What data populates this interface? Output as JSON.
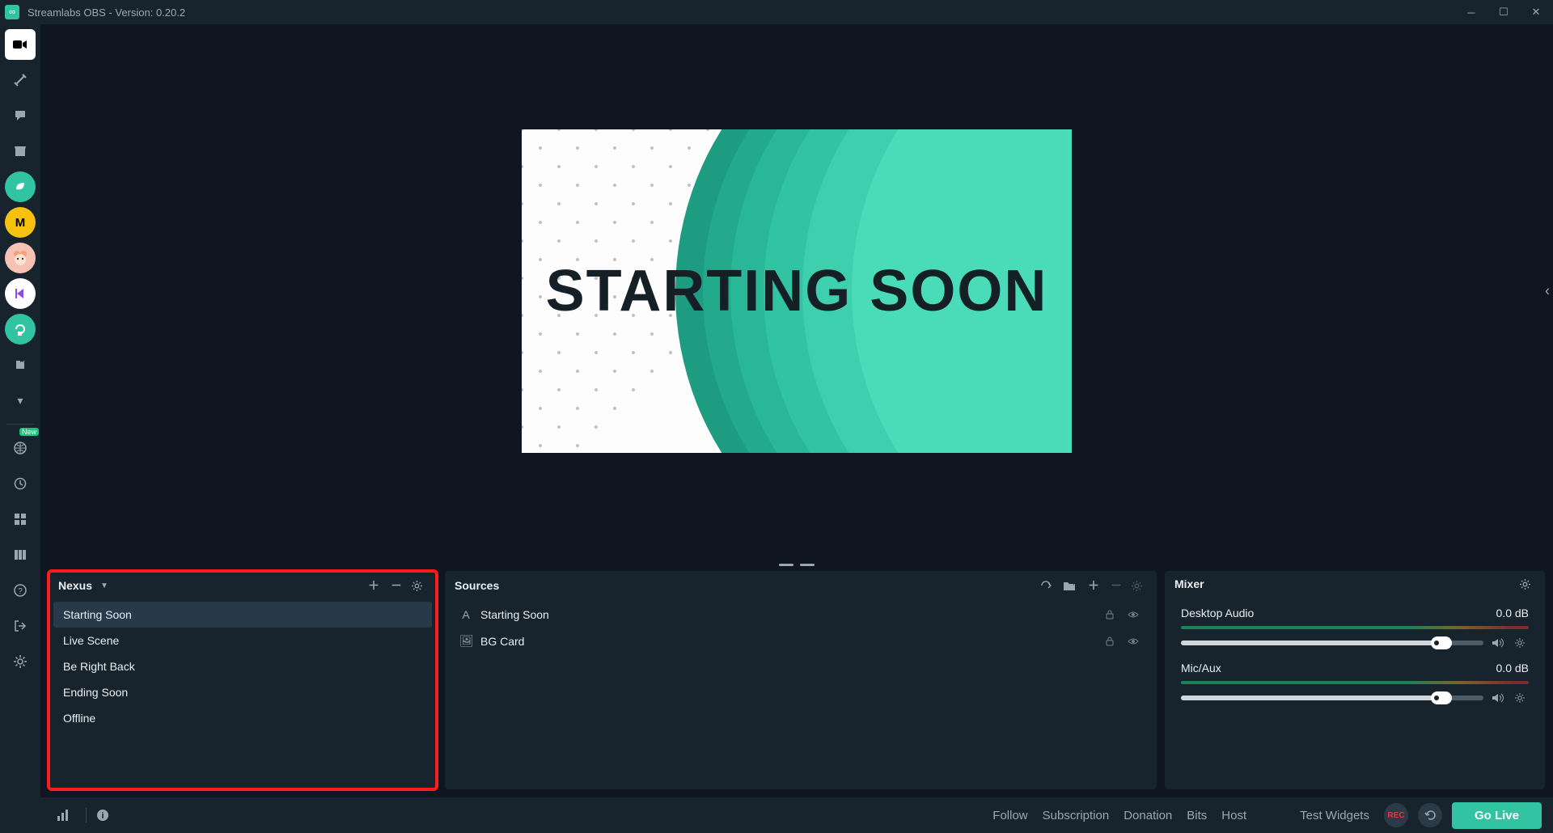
{
  "window": {
    "title": "Streamlabs OBS - Version: 0.20.2"
  },
  "preview": {
    "overlay_text": "STARTING SOON"
  },
  "sidebar": {
    "new_badge": "New"
  },
  "scenes": {
    "title": "Nexus",
    "items": [
      {
        "label": "Starting Soon",
        "active": true
      },
      {
        "label": "Live Scene",
        "active": false
      },
      {
        "label": "Be Right Back",
        "active": false
      },
      {
        "label": "Ending Soon",
        "active": false
      },
      {
        "label": "Offline",
        "active": false
      }
    ]
  },
  "sources": {
    "title": "Sources",
    "items": [
      {
        "icon": "A",
        "label": "Starting Soon"
      },
      {
        "icon": "🖼",
        "label": "BG Card"
      }
    ]
  },
  "mixer": {
    "title": "Mixer",
    "tracks": [
      {
        "name": "Desktop Audio",
        "db": "0.0 dB",
        "fill": 86
      },
      {
        "name": "Mic/Aux",
        "db": "0.0 dB",
        "fill": 86
      }
    ]
  },
  "footer": {
    "events": [
      "Follow",
      "Subscription",
      "Donation",
      "Bits",
      "Host"
    ],
    "test_widgets": "Test Widgets",
    "rec_label": "REC",
    "golive": "Go Live"
  }
}
